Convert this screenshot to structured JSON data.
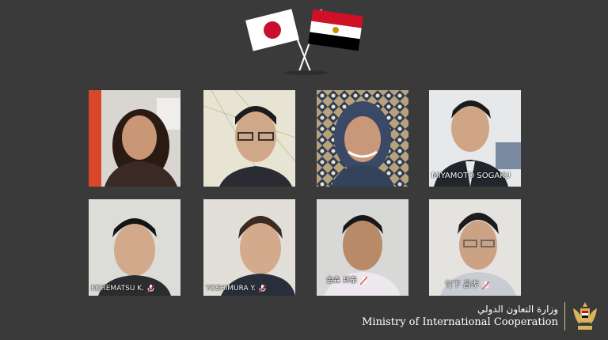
{
  "flags": [
    "japan",
    "egypt"
  ],
  "participants": [
    {
      "name": "",
      "mic_muted": false
    },
    {
      "name": "",
      "mic_muted": false
    },
    {
      "name": "",
      "mic_muted": false
    },
    {
      "name": "MIYAMOTO SOGAKU",
      "mic_muted": false
    },
    {
      "name": "KOREMATSU K.",
      "mic_muted": true
    },
    {
      "name": "YOSHIMURA Y.",
      "mic_muted": true
    },
    {
      "name": "金森 邦泰",
      "mic_muted": true
    },
    {
      "name": "竹下 昌孝",
      "mic_muted": true
    }
  ],
  "ministry": {
    "arabic": "وزارة التعاون الدولي",
    "english": "Ministry of International Cooperation",
    "emblem": "eagle-of-saladin"
  },
  "colors": {
    "background": "#3a3a3a",
    "divider": "#d8c28a"
  }
}
